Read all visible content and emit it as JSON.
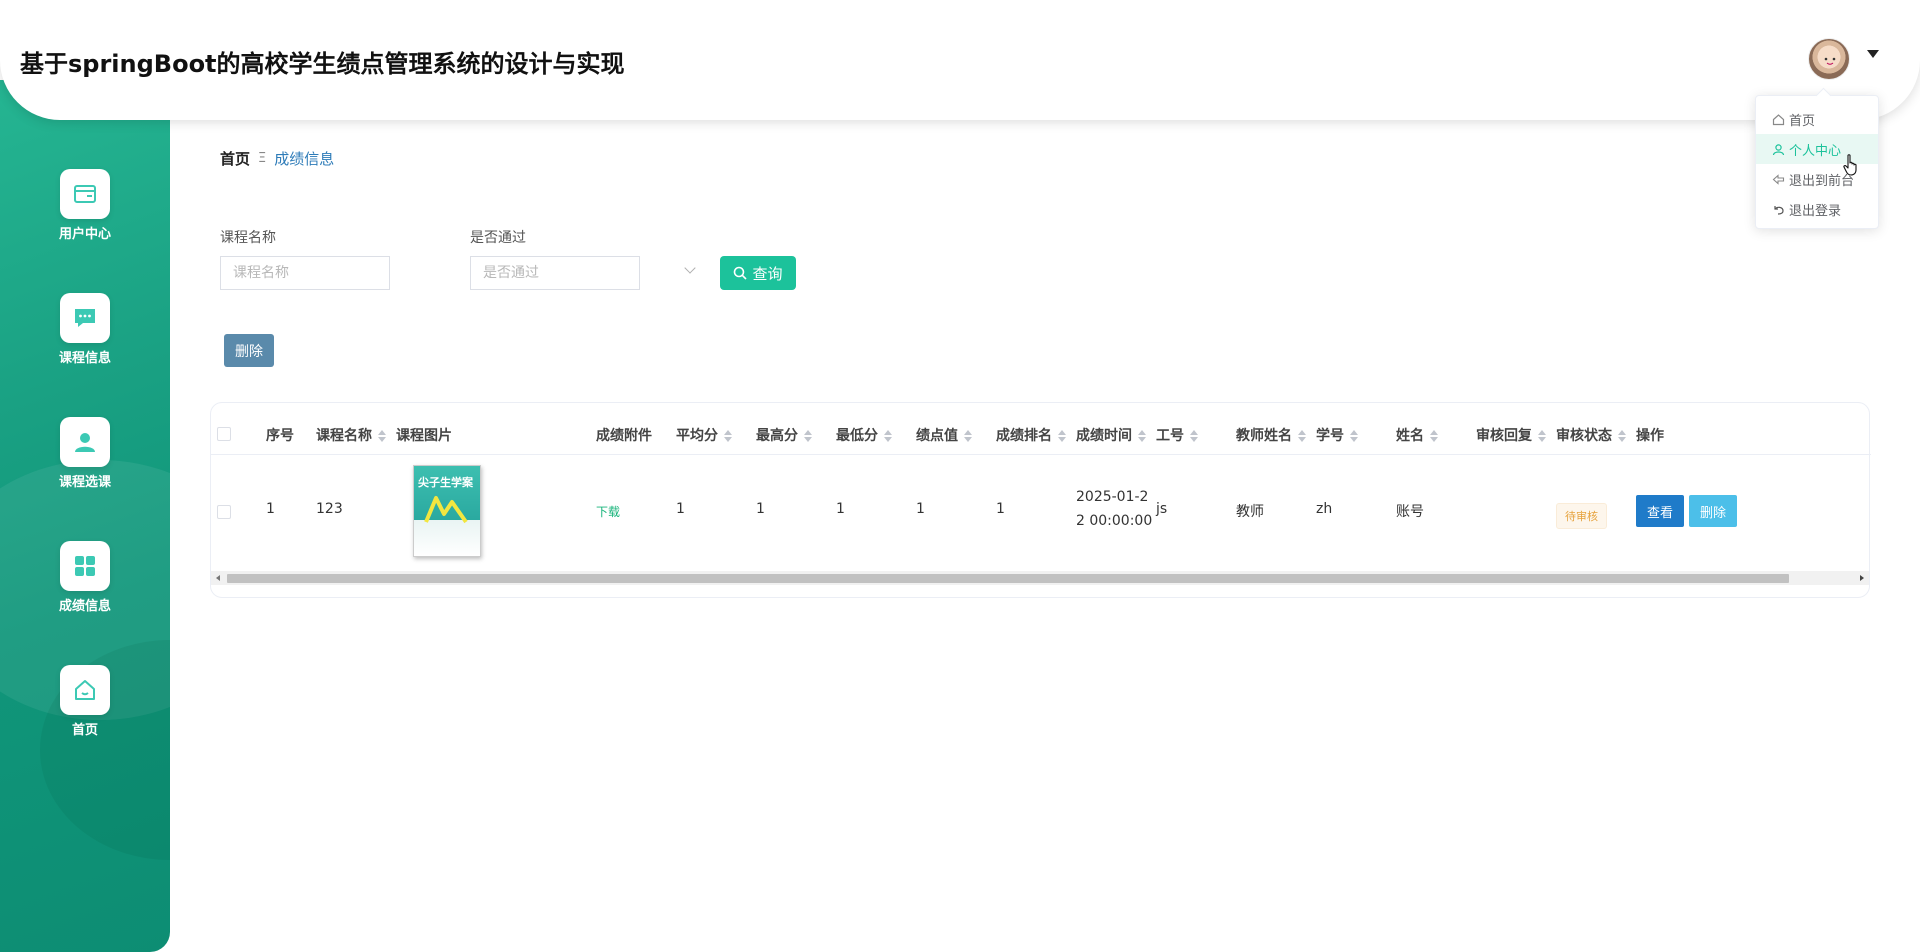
{
  "header": {
    "title": "基于springBoot的高校学生绩点管理系统的设计与实现"
  },
  "sidebar": {
    "items": [
      {
        "label": "用户中心",
        "icon": "card-icon"
      },
      {
        "label": "课程信息",
        "icon": "chat-icon"
      },
      {
        "label": "课程选课",
        "icon": "user-icon"
      },
      {
        "label": "成绩信息",
        "icon": "grid-icon"
      },
      {
        "label": "首页",
        "icon": "home-icon"
      }
    ]
  },
  "breadcrumb": {
    "home": "首页",
    "separator": "Ξ",
    "current": "成绩信息"
  },
  "search": {
    "course_label": "课程名称",
    "course_placeholder": "课程名称",
    "pass_label": "是否通过",
    "pass_placeholder": "是否通过",
    "button": "查询"
  },
  "actions": {
    "delete": "删除"
  },
  "table": {
    "headers": [
      "序号",
      "课程名称",
      "课程图片",
      "成绩附件",
      "平均分",
      "最高分",
      "最低分",
      "绩点值",
      "成绩排名",
      "成绩时间",
      "工号",
      "教师姓名",
      "学号",
      "姓名",
      "审核回复",
      "审核状态",
      "操作"
    ],
    "rows": [
      {
        "index": "1",
        "course": "123",
        "image_title": "尖子生学案",
        "attachment": "下载",
        "avg": "1",
        "max": "1",
        "min": "1",
        "gpa": "1",
        "rank": "1",
        "time_line1": "2025-01-2",
        "time_line2": "2 00:00:00",
        "teacher_id": "js",
        "teacher_name": "教师",
        "student_id": "zh",
        "student_name": "账号",
        "reply": "",
        "status": "待审核",
        "view": "查看",
        "delete": "删除"
      }
    ]
  },
  "dropdown": {
    "items": [
      {
        "label": "首页",
        "icon": "home-icon"
      },
      {
        "label": "个人中心",
        "icon": "user-icon"
      },
      {
        "label": "退出到前台",
        "icon": "arrow-left-icon"
      },
      {
        "label": "退出登录",
        "icon": "undo-icon"
      }
    ]
  },
  "colors": {
    "primary": "#1cc29b",
    "sidebar": "#16a084",
    "link": "#2d7bb8"
  }
}
